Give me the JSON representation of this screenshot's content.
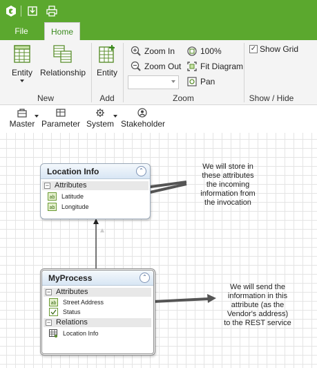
{
  "ribbon_tabs": {
    "file": "File",
    "home": "Home"
  },
  "groups": {
    "new": {
      "label": "New",
      "entity": "Entity",
      "relationship": "Relationship"
    },
    "add": {
      "label": "Add",
      "entity": "Entity"
    },
    "zoom": {
      "label": "Zoom",
      "zoom_in": "Zoom In",
      "zoom_out": "Zoom Out",
      "percent": "100%",
      "fit_diagram": "Fit Diagram",
      "pan": "Pan",
      "zoom_value": ""
    },
    "show_hide": {
      "label": "Show / Hide",
      "show_grid": "Show Grid",
      "show_grid_checked": true
    }
  },
  "toolbar2": {
    "master": "Master",
    "parameter": "Parameter",
    "system": "System",
    "stakeholder": "Stakeholder"
  },
  "diagram": {
    "location_info": {
      "title": "Location Info",
      "attributes_label": "Attributes",
      "fields": [
        "Latitude",
        "Longitude"
      ]
    },
    "my_process": {
      "title": "MyProcess",
      "attributes_label": "Attributes",
      "fields": [
        "Street Address",
        "Status"
      ],
      "relations_label": "Relations",
      "relations": [
        "Location Info"
      ]
    },
    "note_top": [
      "We will store in",
      "these attributes",
      "the incoming",
      "information from",
      "the invocation"
    ],
    "note_bottom": [
      "We will send the",
      "information in this",
      "attribute (as the",
      "Vendor's address)",
      "to the REST service"
    ]
  },
  "colors": {
    "accent": "#5ba82e",
    "ribbon_bg": "#f4f4f4",
    "entity_header": "#d8e6f4"
  },
  "icons": {
    "app": "app-logo-icon",
    "save": "save-icon",
    "print": "print-icon"
  }
}
